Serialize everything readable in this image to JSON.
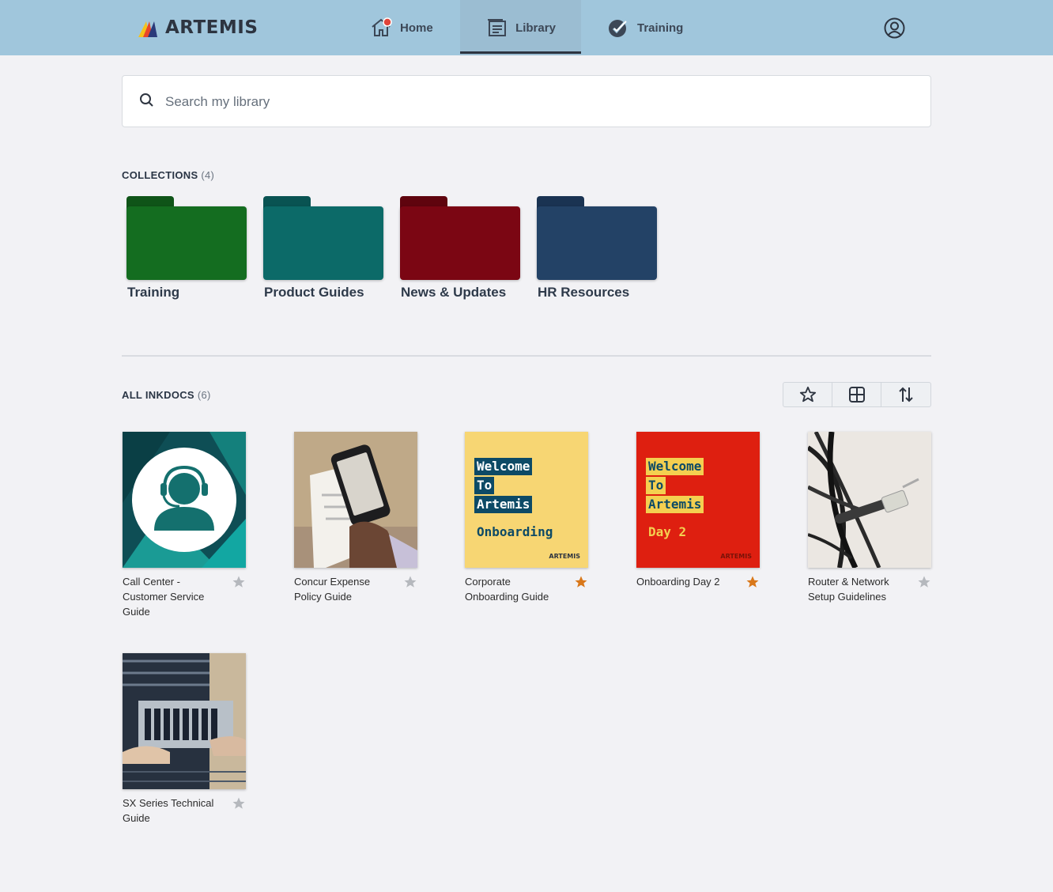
{
  "header": {
    "brand": "ARTEMIS",
    "nav": [
      {
        "label": "Home",
        "icon": "home-icon"
      },
      {
        "label": "Library",
        "icon": "library-icon",
        "active": true
      },
      {
        "label": "Training",
        "icon": "training-check-icon"
      }
    ],
    "profile_icon": "user-circle-icon"
  },
  "search": {
    "placeholder": "Search my library",
    "value": ""
  },
  "collections": {
    "title": "COLLECTIONS",
    "count": "(4)",
    "items": [
      {
        "label": "Training",
        "color": "#146d20",
        "tab_color": "#0f5418"
      },
      {
        "label": "Product Guides",
        "color": "#0c6a68",
        "tab_color": "#095352"
      },
      {
        "label": "News & Updates",
        "color": "#7b0613",
        "tab_color": "#5f040e"
      },
      {
        "label": "HR Resources",
        "color": "#234266",
        "tab_color": "#1a3352"
      }
    ]
  },
  "inkdocs": {
    "title": "ALL INKDOCS",
    "count": "(6)",
    "toolbar": [
      "star-filter-icon",
      "grid-view-icon",
      "sort-icon"
    ],
    "items": [
      {
        "title": "Call Center - Customer Service Guide",
        "starred": false
      },
      {
        "title": "Concur Expense Policy Guide",
        "starred": false
      },
      {
        "title": "Corporate Onboarding Guide",
        "starred": true,
        "thumb": {
          "line1": "Welcome",
          "line2": "To",
          "line3": "Artemis",
          "line4": "Onboarding",
          "brand": "ARTEMIS"
        }
      },
      {
        "title": "Onboarding Day 2",
        "starred": true,
        "thumb": {
          "line1": "Welcome",
          "line2": "To",
          "line3": "Artemis",
          "line4": "Day 2",
          "brand": "ARTEMIS"
        }
      },
      {
        "title": "Router & Network Setup Guidelines",
        "starred": false
      },
      {
        "title": "SX Series Technical Guide",
        "starred": false
      }
    ]
  },
  "colors": {
    "header_bg": "#a0c6dc",
    "star_active": "#d9781a",
    "star_inactive": "#b5b8bd"
  }
}
